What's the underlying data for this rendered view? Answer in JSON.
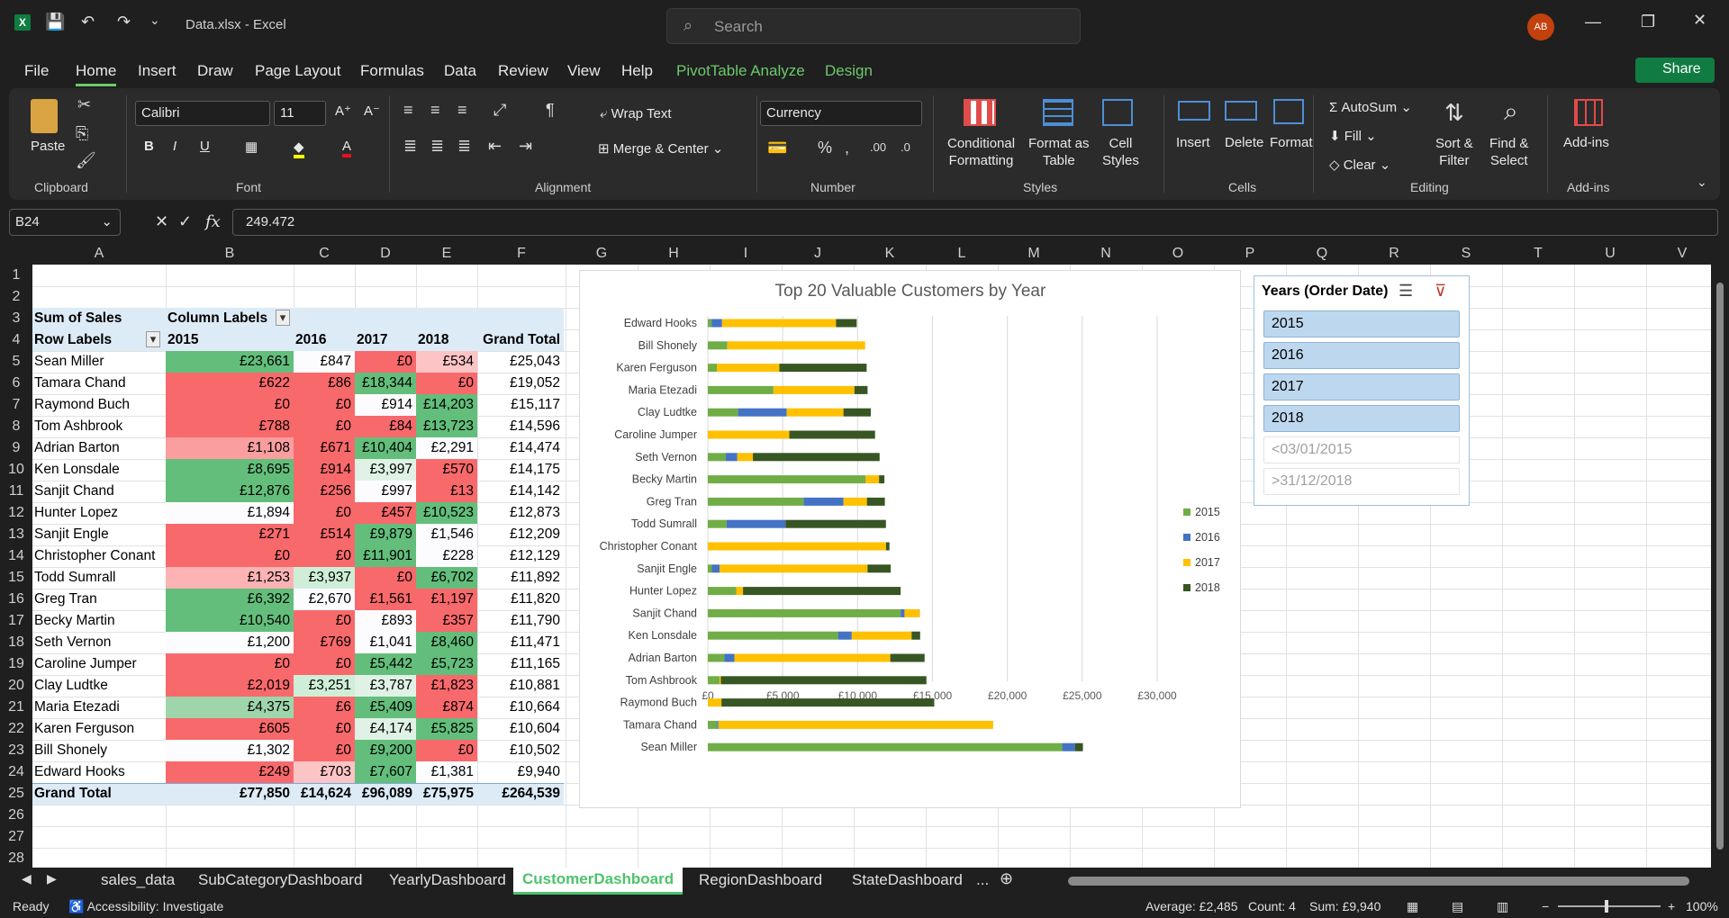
{
  "window": {
    "filename": "Data.xlsx",
    "app": "Excel",
    "search_placeholder": "Search",
    "avatar": "AB"
  },
  "menu": [
    "File",
    "Home",
    "Insert",
    "Draw",
    "Page Layout",
    "Formulas",
    "Data",
    "Review",
    "View",
    "Help",
    "PivotTable Analyze",
    "Design"
  ],
  "share_label": "Share",
  "ribbon": {
    "groups": [
      "Clipboard",
      "Font",
      "Alignment",
      "Number",
      "Styles",
      "Cells",
      "Editing",
      "Add-ins"
    ],
    "paste": "Paste",
    "font_name": "Calibri",
    "font_size": "11",
    "wrap_text": "Wrap Text",
    "merge_center": "Merge & Center",
    "number_format": "Currency",
    "cond_fmt_1": "Conditional",
    "cond_fmt_2": "Formatting",
    "fmt_table_1": "Format as",
    "fmt_table_2": "Table",
    "cell_styles_1": "Cell",
    "cell_styles_2": "Styles",
    "insert": "Insert",
    "delete": "Delete",
    "format": "Format",
    "autosum": "AutoSum",
    "fill": "Fill",
    "clear": "Clear",
    "sort_1": "Sort &",
    "sort_2": "Filter",
    "find_1": "Find &",
    "find_2": "Select",
    "addins": "Add-ins"
  },
  "formula_bar": {
    "name_box": "B24",
    "fx": "fx",
    "value": "249.472"
  },
  "columns": [
    "A",
    "B",
    "C",
    "D",
    "E",
    "F",
    "G",
    "H",
    "I",
    "J",
    "K",
    "L",
    "M",
    "N",
    "O",
    "P",
    "Q",
    "R",
    "S",
    "T",
    "U",
    "V"
  ],
  "rows": [
    "1",
    "2",
    "3",
    "4",
    "5",
    "6",
    "7",
    "8",
    "9",
    "10",
    "11",
    "12",
    "13",
    "14",
    "15",
    "16",
    "17",
    "18",
    "19",
    "20",
    "21",
    "22",
    "23",
    "24",
    "25",
    "26",
    "27",
    "28"
  ],
  "pivot": {
    "sum_label": "Sum of Sales",
    "col_labels": "Column Labels",
    "row_labels": "Row Labels",
    "headers": [
      "2015",
      "2016",
      "2017",
      "2018",
      "Grand Total"
    ],
    "rows": [
      {
        "name": "Sean Miller",
        "v": [
          "£23,661",
          "£847",
          "£0",
          "£534",
          "£25,043"
        ]
      },
      {
        "name": "Tamara Chand",
        "v": [
          "£622",
          "£86",
          "£18,344",
          "£0",
          "£19,052"
        ]
      },
      {
        "name": "Raymond Buch",
        "v": [
          "£0",
          "£0",
          "£914",
          "£14,203",
          "£15,117"
        ]
      },
      {
        "name": "Tom Ashbrook",
        "v": [
          "£788",
          "£0",
          "£84",
          "£13,723",
          "£14,596"
        ]
      },
      {
        "name": "Adrian Barton",
        "v": [
          "£1,108",
          "£671",
          "£10,404",
          "£2,291",
          "£14,474"
        ]
      },
      {
        "name": "Ken Lonsdale",
        "v": [
          "£8,695",
          "£914",
          "£3,997",
          "£570",
          "£14,175"
        ]
      },
      {
        "name": "Sanjit Chand",
        "v": [
          "£12,876",
          "£256",
          "£997",
          "£13",
          "£14,142"
        ]
      },
      {
        "name": "Hunter Lopez",
        "v": [
          "£1,894",
          "£0",
          "£457",
          "£10,523",
          "£12,873"
        ]
      },
      {
        "name": "Sanjit Engle",
        "v": [
          "£271",
          "£514",
          "£9,879",
          "£1,546",
          "£12,209"
        ]
      },
      {
        "name": "Christopher Conant",
        "v": [
          "£0",
          "£0",
          "£11,901",
          "£228",
          "£12,129"
        ]
      },
      {
        "name": "Todd Sumrall",
        "v": [
          "£1,253",
          "£3,937",
          "£0",
          "£6,702",
          "£11,892"
        ]
      },
      {
        "name": "Greg Tran",
        "v": [
          "£6,392",
          "£2,670",
          "£1,561",
          "£1,197",
          "£11,820"
        ]
      },
      {
        "name": "Becky Martin",
        "v": [
          "£10,540",
          "£0",
          "£893",
          "£357",
          "£11,790"
        ]
      },
      {
        "name": "Seth Vernon",
        "v": [
          "£1,200",
          "£769",
          "£1,041",
          "£8,460",
          "£11,471"
        ]
      },
      {
        "name": "Caroline Jumper",
        "v": [
          "£0",
          "£0",
          "£5,442",
          "£5,723",
          "£11,165"
        ]
      },
      {
        "name": "Clay Ludtke",
        "v": [
          "£2,019",
          "£3,251",
          "£3,787",
          "£1,823",
          "£10,881"
        ]
      },
      {
        "name": "Maria Etezadi",
        "v": [
          "£4,375",
          "£6",
          "£5,409",
          "£874",
          "£10,664"
        ]
      },
      {
        "name": "Karen Ferguson",
        "v": [
          "£605",
          "£0",
          "£4,174",
          "£5,825",
          "£10,604"
        ]
      },
      {
        "name": "Bill Shonely",
        "v": [
          "£1,302",
          "£0",
          "£9,200",
          "£0",
          "£10,502"
        ]
      },
      {
        "name": "Edward Hooks",
        "v": [
          "£249",
          "£703",
          "£7,607",
          "£1,381",
          "£9,940"
        ]
      }
    ],
    "grand_total": {
      "name": "Grand Total",
      "v": [
        "£77,850",
        "£14,624",
        "£96,089",
        "£75,975",
        "£264,539"
      ]
    },
    "heat": {
      "col2015": [
        "#63be7b",
        "#f8696b",
        "#f8696b",
        "#f8696b",
        "#fa9e9f",
        "#63be7b",
        "#63be7b",
        "#fcfcff",
        "#f8696b",
        "#f8696b",
        "#fbb3b4",
        "#63be7b",
        "#63be7b",
        "#fcfcff",
        "#f8696b",
        "#f8696b",
        "#9ed5ab",
        "#f8696b",
        "#fcfcff",
        "#f8696b"
      ],
      "col2016": [
        "#fcfcff",
        "#f8696b",
        "#f8696b",
        "#f8696b",
        "#f8696b",
        "#f8696b",
        "#f8696b",
        "#f8696b",
        "#f8696b",
        "#f8696b",
        "#cfeed8",
        "#fcfcff",
        "#f8696b",
        "#f8696b",
        "#f8696b",
        "#cfeed8",
        "#f8696b",
        "#f8696b",
        "#f8696b",
        "#fcc4c5"
      ],
      "col2017": [
        "#f8696b",
        "#63be7b",
        "#fcfcff",
        "#f8696b",
        "#63be7b",
        "#dff2e5",
        "#fcfcff",
        "#f8696b",
        "#63be7b",
        "#63be7b",
        "#f8696b",
        "#f8696b",
        "#fcfcff",
        "#fcfcff",
        "#63be7b",
        "#dff2e5",
        "#63be7b",
        "#dff2e5",
        "#63be7b",
        "#63be7b"
      ],
      "col2018": [
        "#fcc4c5",
        "#f8696b",
        "#63be7b",
        "#63be7b",
        "#fcfcff",
        "#f8696b",
        "#f8696b",
        "#63be7b",
        "#fcfcff",
        "#fcfcff",
        "#63be7b",
        "#f8696b",
        "#f8696b",
        "#63be7b",
        "#63be7b",
        "#f8696b",
        "#f8696b",
        "#63be7b",
        "#f8696b",
        "#fcfcff"
      ]
    }
  },
  "slicer": {
    "title": "Years (Order Date)",
    "items": [
      {
        "label": "2015",
        "state": "sel"
      },
      {
        "label": "2016",
        "state": "sel"
      },
      {
        "label": "2017",
        "state": "sel"
      },
      {
        "label": "2018",
        "state": "sel"
      },
      {
        "label": "<03/01/2015",
        "state": "dis"
      },
      {
        "label": ">31/12/2018",
        "state": "dis"
      }
    ]
  },
  "sheet_tabs": [
    "sales_data",
    "SubCategoryDashboard",
    "YearlyDashboard",
    "CustomerDashboard",
    "RegionDashboard",
    "StateDashboard",
    "..."
  ],
  "active_tab": "CustomerDashboard",
  "status": {
    "ready": "Ready",
    "accessibility": "Accessibility: Investigate",
    "average": "Average: £2,485",
    "count": "Count: 4",
    "sum": "Sum: £9,940",
    "zoom": "100%"
  },
  "colors": {
    "y2015": "#70ad47",
    "y2016": "#4472c4",
    "y2017": "#ffc000",
    "y2018": "#375623"
  },
  "chart_data": {
    "type": "bar",
    "orientation": "horizontal-stacked",
    "title": "Top 20 Valuable Customers by Year",
    "categories": [
      "Edward Hooks",
      "Bill Shonely",
      "Karen Ferguson",
      "Maria Etezadi",
      "Clay Ludtke",
      "Caroline Jumper",
      "Seth Vernon",
      "Becky Martin",
      "Greg Tran",
      "Todd Sumrall",
      "Christopher Conant",
      "Sanjit Engle",
      "Hunter Lopez",
      "Sanjit Chand",
      "Ken Lonsdale",
      "Adrian Barton",
      "Tom Ashbrook",
      "Raymond Buch",
      "Tamara Chand",
      "Sean Miller"
    ],
    "series": [
      {
        "name": "2015",
        "values": [
          249,
          1302,
          605,
          4375,
          2019,
          0,
          1200,
          10540,
          6392,
          1253,
          0,
          271,
          1894,
          12876,
          8695,
          1108,
          788,
          0,
          622,
          23661
        ]
      },
      {
        "name": "2016",
        "values": [
          703,
          0,
          0,
          6,
          3251,
          0,
          769,
          0,
          2670,
          3937,
          0,
          514,
          0,
          256,
          914,
          671,
          0,
          0,
          86,
          847
        ]
      },
      {
        "name": "2017",
        "values": [
          7607,
          9200,
          4174,
          5409,
          3787,
          5442,
          1041,
          893,
          1561,
          0,
          11901,
          9879,
          457,
          997,
          3997,
          10404,
          84,
          914,
          18344,
          0
        ]
      },
      {
        "name": "2018",
        "values": [
          1381,
          0,
          5825,
          874,
          1823,
          5723,
          8460,
          357,
          1197,
          6702,
          228,
          1546,
          10523,
          13,
          570,
          2291,
          13723,
          14203,
          0,
          534
        ]
      }
    ],
    "xlim": [
      0,
      30000
    ],
    "xticks": [
      "£0",
      "£5,000",
      "£10,000",
      "£15,000",
      "£20,000",
      "£25,000",
      "£30,000"
    ],
    "legend": "right",
    "grid": true
  }
}
